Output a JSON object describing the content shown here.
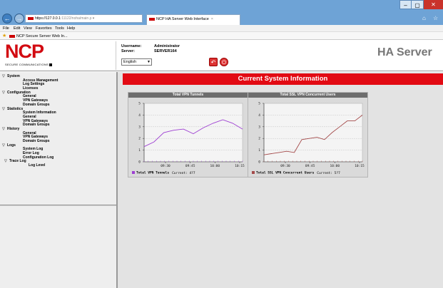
{
  "browser": {
    "url_host": "https://127.0.0.1",
    "url_rest": ":11122/noha/main",
    "url_suffix": "ρ ▾",
    "tab_title": "NCP HA Server Web Interface",
    "tab_close": "×",
    "menu": [
      "File",
      "Edit",
      "View",
      "Favorites",
      "Tools",
      "Help"
    ],
    "favorite_link": "NCP Secure Server Web In..."
  },
  "header": {
    "logo": "NCP",
    "logo_subtitle": "SECURE COMMUNICATIONS",
    "username_label": "Username:",
    "username_value": "Administrator",
    "server_label": "Server:",
    "server_value": "SERVER164",
    "language": "English",
    "product_name": "HA Server"
  },
  "sidebar": {
    "items": [
      {
        "label": "System",
        "level": "lvl1",
        "toggle": "open"
      },
      {
        "label": "Access Management",
        "level": "lvl2"
      },
      {
        "label": "Log Settings",
        "level": "lvl2"
      },
      {
        "label": "Licenses",
        "level": "lvl2"
      },
      {
        "label": "Configuration",
        "level": "lvl1",
        "toggle": "open"
      },
      {
        "label": "General",
        "level": "lvl2"
      },
      {
        "label": "VPN Gateways",
        "level": "lvl2"
      },
      {
        "label": "Domain Groups",
        "level": "lvl2"
      },
      {
        "label": "Statistics",
        "level": "lvl1",
        "toggle": "open"
      },
      {
        "label": "System Information",
        "level": "lvl2"
      },
      {
        "label": "General",
        "level": "lvl2"
      },
      {
        "label": "VPN Gateways",
        "level": "lvl2"
      },
      {
        "label": "Domain Groups",
        "level": "lvl2"
      },
      {
        "label": "History",
        "level": "lvl1",
        "toggle": "open"
      },
      {
        "label": "General",
        "level": "lvl2"
      },
      {
        "label": "VPN Gateways",
        "level": "lvl2"
      },
      {
        "label": "Domain Groups",
        "level": "lvl2"
      },
      {
        "label": "Logs",
        "level": "lvl1",
        "toggle": "open"
      },
      {
        "label": "System Log",
        "level": "lvl2"
      },
      {
        "label": "Error Log",
        "level": "lvl2"
      },
      {
        "label": "Configuration Log",
        "level": "lvl2"
      },
      {
        "label": "Trace Log",
        "level": "lvl2b",
        "toggle": "open"
      },
      {
        "label": "Log Level",
        "level": "lvl3"
      }
    ]
  },
  "main": {
    "title": "Current System Information"
  },
  "chart_data": [
    {
      "type": "line",
      "title": "Total VPN Tunnels",
      "x": [
        "09:30",
        "09:45",
        "10:00",
        "10:15"
      ],
      "ylim": [
        0,
        5
      ],
      "yticks": [
        "0",
        "1",
        "2",
        "3",
        "4",
        "5"
      ],
      "grid": true,
      "color": "#9e3fd2",
      "series": [
        {
          "name": "Total VPN Tunnels",
          "values": [
            1.3,
            1.7,
            2.5,
            2.7,
            2.8,
            2.4,
            2.9,
            3.3,
            3.6,
            3.3,
            2.8
          ]
        }
      ],
      "legend_current": "Current: 4?7"
    },
    {
      "type": "line",
      "title": "Total SSL VPN Concurrent Users",
      "x": [
        "09:30",
        "09:45",
        "10:00",
        "10:15"
      ],
      "ylim": [
        0,
        5
      ],
      "yticks": [
        "0",
        "1",
        "2",
        "3",
        "4",
        "5"
      ],
      "grid": true,
      "color": "#a44a4a",
      "series": [
        {
          "name": "Total SSL VPN Concurrent Users",
          "values": [
            0.6,
            0.7,
            0.8,
            0.9,
            0.8,
            1.9,
            2.0,
            2.1,
            1.9,
            2.5,
            3.0,
            3.5,
            3.5,
            4.0
          ]
        }
      ],
      "legend_current": "Current: 5?7"
    }
  ]
}
